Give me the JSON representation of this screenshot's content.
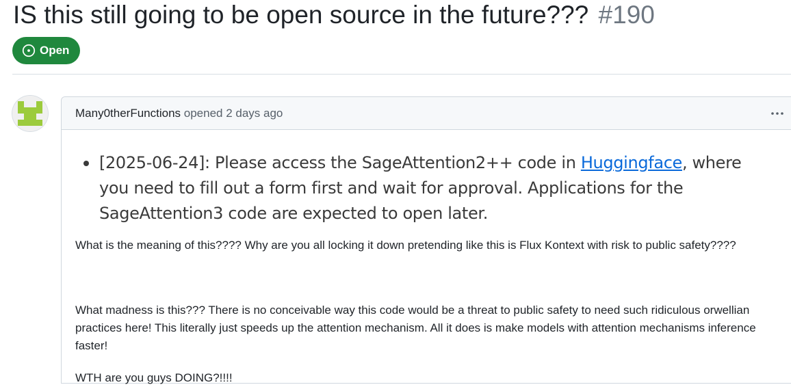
{
  "issue": {
    "title": "IS this still going to be open source in the future???",
    "number": "#190",
    "state_label": "Open",
    "state_color": "#1f883d"
  },
  "comment": {
    "author": "Many0therFunctions",
    "action": "opened 2 days ago",
    "avatar_icon": "identicon-avatar-icon",
    "menu_icon": "kebab-horizontal-icon",
    "quote": {
      "prefix": "[2025-06-24]: Please access the SageAttention2++ code in ",
      "link_text": "Huggingface",
      "suffix": ", where you need to fill out a form first and wait for approval. Applications for the SageAttention3 code are expected to open later."
    },
    "paragraphs": [
      "What is the meaning of this???? Why are you all locking it down pretending like this is Flux Kontext with risk to public safety????",
      "What madness is this??? There is no conceivable way this code would be a threat to public safety to need such ridiculous orwellian practices here! This literally just speeds up the attention mechanism. All it does is make models with attention mechanisms inference faster!",
      "WTH are you guys DOING?!!!!"
    ]
  },
  "colors": {
    "link": "#0969da",
    "muted": "#57606a",
    "avatar_green": "#9ccb3c"
  }
}
